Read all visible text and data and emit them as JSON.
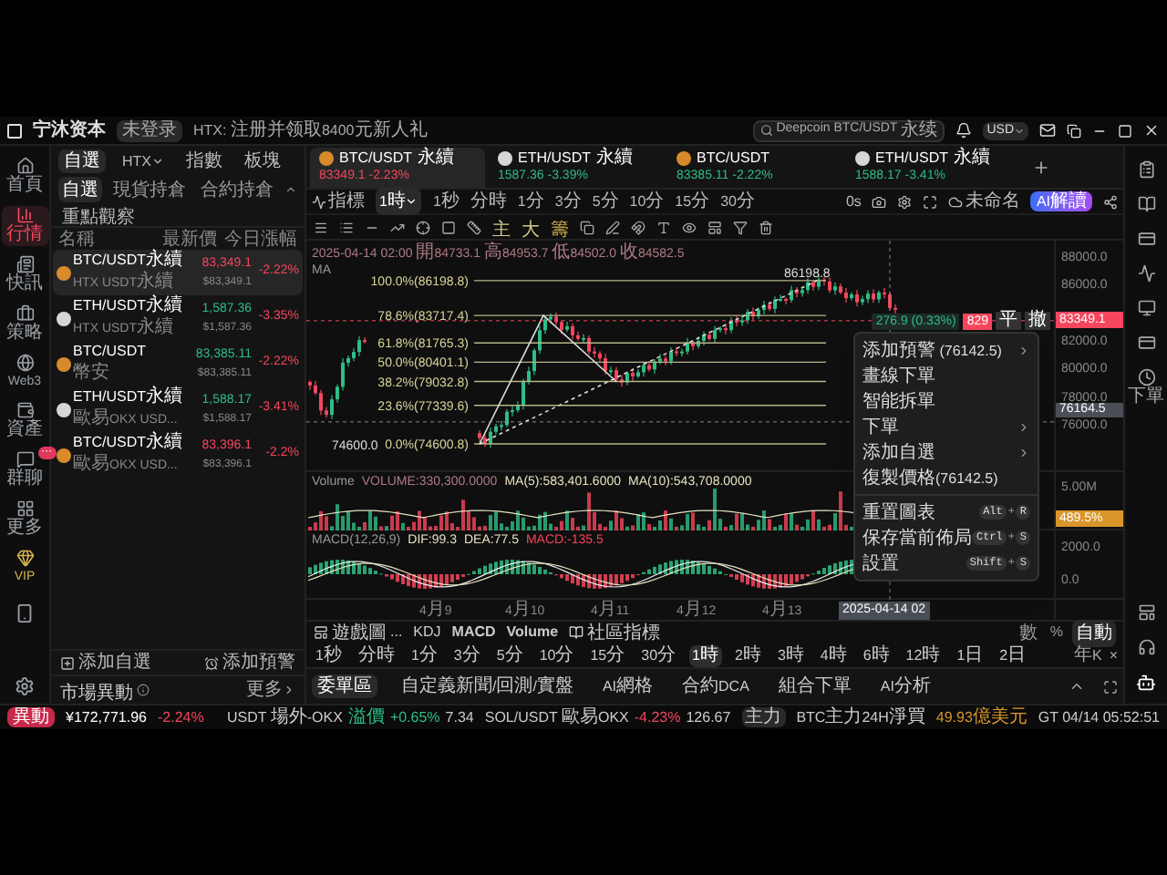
{
  "app": {
    "brand": "宁沐资本",
    "login": "未登录",
    "promo": "HTX: 注册并领取8400元新人礼",
    "search": "Deepcoin BTC/USDT 永续",
    "currency": "USD"
  },
  "rail": [
    {
      "label": "首頁",
      "selected": false,
      "kind": "nav"
    },
    {
      "label": "行情",
      "selected": true,
      "kind": "nav"
    },
    {
      "label": "快訊",
      "selected": false,
      "kind": "nav"
    },
    {
      "label": "策略",
      "selected": false,
      "kind": "nav"
    },
    {
      "label": "Web3",
      "selected": false,
      "kind": "nav"
    },
    {
      "label": "資產",
      "selected": false,
      "kind": "nav"
    },
    {
      "label": "群聊",
      "selected": false,
      "kind": "nav",
      "badge": "···"
    },
    {
      "label": "更多",
      "selected": false,
      "kind": "nav"
    },
    {
      "label": "VIP",
      "selected": false,
      "kind": "vip"
    }
  ],
  "watchlist": {
    "tabs": [
      {
        "label": "自選",
        "selected": true,
        "dropdown": false
      },
      {
        "label": "HTX",
        "selected": false,
        "dropdown": true
      },
      {
        "label": "指數",
        "selected": false,
        "dropdown": false
      },
      {
        "label": "板塊",
        "selected": false,
        "dropdown": false
      }
    ],
    "subtabs": [
      {
        "label": "自選",
        "selected": true
      },
      {
        "label": "現貨持倉",
        "selected": false
      },
      {
        "label": "合約持倉",
        "selected": false
      }
    ],
    "group": "重點觀察",
    "columns": [
      "名稱",
      "最新價",
      "今日漲幅"
    ],
    "rows": [
      {
        "name": "BTC/USDT永續",
        "exchange": "HTX USDT永續",
        "price": "83,349.1",
        "fiat": "$83,349.1",
        "change": "-2.22%",
        "falling": true,
        "selected": true,
        "kind": "btc"
      },
      {
        "name": "ETH/USDT永續",
        "exchange": "HTX USDT永續",
        "price": "1,587.36",
        "fiat": "$1,587.36",
        "change": "-3.35%",
        "falling": false,
        "selected": false,
        "kind": "eth"
      },
      {
        "name": "BTC/USDT",
        "exchange": "幣安",
        "price": "83,385.11",
        "fiat": "$83,385.11",
        "change": "-2.22%",
        "falling": false,
        "selected": false,
        "kind": "btc"
      },
      {
        "name": "ETH/USDT永續",
        "exchange": "歐易OKX USD...",
        "price": "1,588.17",
        "fiat": "$1,588.17",
        "change": "-3.41%",
        "falling": false,
        "selected": false,
        "kind": "eth"
      },
      {
        "name": "BTC/USDT永續",
        "exchange": "歐易OKX USD...",
        "price": "83,396.1",
        "fiat": "$83,396.1",
        "change": "-2.2%",
        "falling": true,
        "selected": false,
        "kind": "btc"
      }
    ],
    "add_watch": "添加自選",
    "add_alert": "添加預警",
    "movers": "市場異動",
    "more": "更多"
  },
  "chart_tabs": [
    {
      "name": "BTC/USDT永續",
      "price": "83349.1",
      "change": "-2.23%",
      "falling": true,
      "selected": true,
      "kind": "btc"
    },
    {
      "name": "ETH/USDT永續",
      "price": "1587.36",
      "change": "-3.39%",
      "falling": false,
      "selected": false,
      "kind": "eth"
    },
    {
      "name": "BTC/USDT",
      "price": "83385.11",
      "change": "-2.22%",
      "falling": false,
      "selected": false,
      "kind": "btc"
    },
    {
      "name": "ETH/USDT永續",
      "price": "1588.17",
      "change": "-3.41%",
      "falling": false,
      "selected": false,
      "kind": "eth"
    }
  ],
  "toolbar": {
    "indicators": "指標",
    "interval": "1時",
    "intervals": [
      "1秒",
      "分時",
      "1分",
      "3分",
      "5分",
      "10分",
      "15分",
      "30分"
    ],
    "countdown": "0s",
    "layout": "未命名",
    "ai": "AI解讀"
  },
  "draw_tools": [
    "主",
    "大",
    "籌"
  ],
  "chart": {
    "ohlc": "2025-04-14 02:00 開84733.1 高84953.7 低84502.0 收84582.5",
    "ma": "MA",
    "high_label": "86198.8",
    "low_label": "74600.0",
    "fib": [
      "100.0%(86198.8)",
      "78.6%(83717.4)",
      "61.8%(81765.3)",
      "50.0%(80401.1)",
      "38.2%(79032.8)",
      "23.6%(77339.6)",
      "0.0%(74600.8)"
    ],
    "price_axis": [
      "88000.0",
      "86000.0",
      "82000.0",
      "80000.0",
      "78000.0",
      "76000.0"
    ],
    "last_price": "83349.1",
    "cursor_price": "76164.5",
    "position": {
      "pnl": "276.9 (0.33%)",
      "qty": "829",
      "close": "平",
      "cancel": "撤"
    }
  },
  "volume": {
    "label": "Volume",
    "values": [
      "VOLUME:330,300.0000",
      "MA(5):583,401.6000",
      "MA(10):543,708.0000"
    ],
    "axis": [
      "5.00M"
    ],
    "tag": "489.5%"
  },
  "macd": {
    "label": "MACD(12,26,9)",
    "values": [
      "DIF:99.3",
      "DEA:77.5",
      "MACD:-135.5"
    ],
    "axis": [
      "2000.0",
      "0.0"
    ]
  },
  "time_axis": [
    "4月9",
    "4月10",
    "4月11",
    "4月12",
    "4月13"
  ],
  "cursor_time": "2025-04-14 02",
  "indicator_bar": {
    "template": "遊戲圖...",
    "indicators": [
      "KDJ",
      "MACD",
      "Volume"
    ],
    "community": "社區指標",
    "scale": [
      {
        "label": "數",
        "selected": false
      },
      {
        "label": "%",
        "selected": false
      },
      {
        "label": "自動",
        "selected": true
      }
    ]
  },
  "periods": [
    {
      "label": "1秒",
      "selected": false
    },
    {
      "label": "分時",
      "selected": false
    },
    {
      "label": "1分",
      "selected": false
    },
    {
      "label": "3分",
      "selected": false
    },
    {
      "label": "5分",
      "selected": false
    },
    {
      "label": "10分",
      "selected": false
    },
    {
      "label": "15分",
      "selected": false
    },
    {
      "label": "30分",
      "selected": false
    },
    {
      "label": "1時",
      "selected": true
    },
    {
      "label": "2時",
      "selected": false
    },
    {
      "label": "3時",
      "selected": false
    },
    {
      "label": "4時",
      "selected": false
    },
    {
      "label": "6時",
      "selected": false
    },
    {
      "label": "12時",
      "selected": false
    },
    {
      "label": "1日",
      "selected": false
    },
    {
      "label": "2日",
      "selected": false
    }
  ],
  "periods_right": [
    "年K",
    "×"
  ],
  "bottom_tabs": [
    {
      "label": "委單區",
      "selected": true
    },
    {
      "label": "自定義新聞/回測/實盤",
      "selected": false
    },
    {
      "label": "AI網格",
      "selected": false
    },
    {
      "label": "合約DCA",
      "selected": false
    },
    {
      "label": "組合下單",
      "selected": false
    },
    {
      "label": "AI分析",
      "selected": false
    }
  ],
  "menu": [
    {
      "label": "添加預警 (76142.5)",
      "kind": "submenu"
    },
    {
      "label": "畫線下單",
      "kind": "item"
    },
    {
      "label": "智能拆單",
      "kind": "item"
    },
    {
      "label": "下單",
      "kind": "submenu"
    },
    {
      "label": "添加自選",
      "kind": "submenu"
    },
    {
      "label": "復製價格(76142.5)",
      "kind": "item"
    },
    {
      "kind": "separator"
    },
    {
      "label": "重置圖表",
      "kind": "shortcut",
      "keys": [
        "Alt",
        "+",
        "R"
      ]
    },
    {
      "label": "保存當前佈局",
      "kind": "shortcut",
      "keys": [
        "Ctrl",
        "+",
        "S"
      ]
    },
    {
      "label": "設置",
      "kind": "shortcut",
      "keys": [
        "Shift",
        "+",
        "S"
      ]
    }
  ],
  "right_rail": {
    "order": "下單"
  },
  "status": {
    "badge": "異動",
    "total": "¥172,771.96",
    "total_change": "-2.24%",
    "tickers": [
      {
        "name": "USDT 場外-OKX",
        "tag": "溢價",
        "change": "+0.65%",
        "value": "7.34",
        "falling": false
      },
      {
        "name": "SOL/USDT 歐易OKX",
        "change": "-4.23%",
        "value": "126.67",
        "falling": true
      }
    ],
    "flow_badge": "主力",
    "flow": "BTC主力24H淨買",
    "flow_value": "49.93億美元",
    "time": "GT 04/14 05:52:51"
  }
}
